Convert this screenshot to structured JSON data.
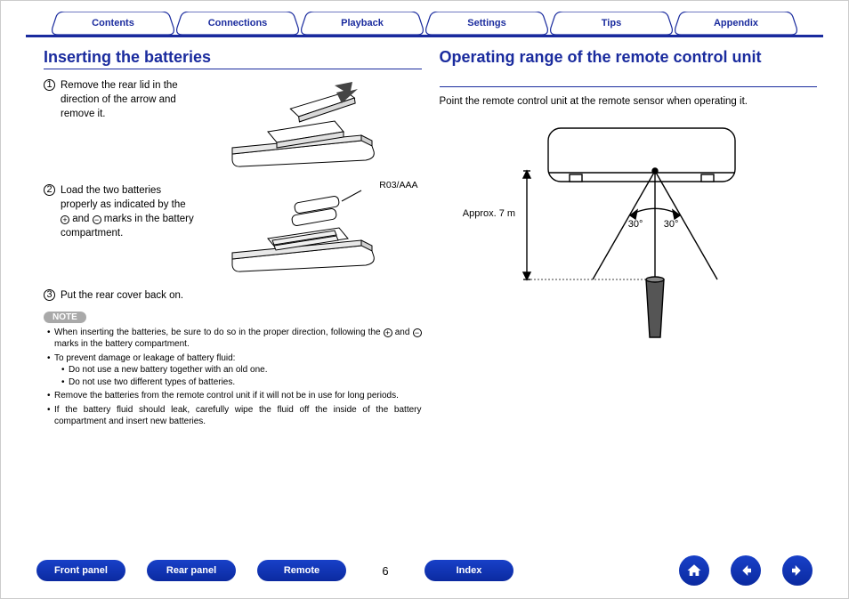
{
  "top_tabs": [
    "Contents",
    "Connections",
    "Playback",
    "Settings",
    "Tips",
    "Appendix"
  ],
  "left": {
    "title": "Inserting the batteries",
    "steps": [
      "Remove the rear lid in the direction of the arrow and remove it.",
      "Load the two batteries properly as indicated by the ⊕ and ⊖ marks in the battery compartment.",
      "Put the rear cover back on."
    ],
    "battery_type": "R03/AAA",
    "note_label": "NOTE",
    "notes": [
      "When inserting the batteries, be sure to do so in the proper direction, following the ⊕ and ⊖ marks in the battery compartment.",
      "To prevent damage or leakage of battery fluid:",
      "Remove the batteries from the remote control unit if it will not be in use for long periods.",
      "If the battery fluid should leak, carefully wipe the fluid off the inside of the battery compartment and insert new batteries."
    ],
    "sub_notes": [
      "Do not use a new battery together with an old one.",
      "Do not use two different types of batteries."
    ]
  },
  "right": {
    "title": "Operating range of the remote control unit",
    "intro": "Point the remote control unit at the remote sensor when operating it.",
    "distance": "Approx. 7 m",
    "angle_left": "30°",
    "angle_right": "30°"
  },
  "footer": {
    "buttons": [
      "Front panel",
      "Rear panel",
      "Remote",
      "Index"
    ],
    "page": "6",
    "nav_icons": [
      "home-icon",
      "arrow-left-icon",
      "arrow-right-icon"
    ]
  }
}
